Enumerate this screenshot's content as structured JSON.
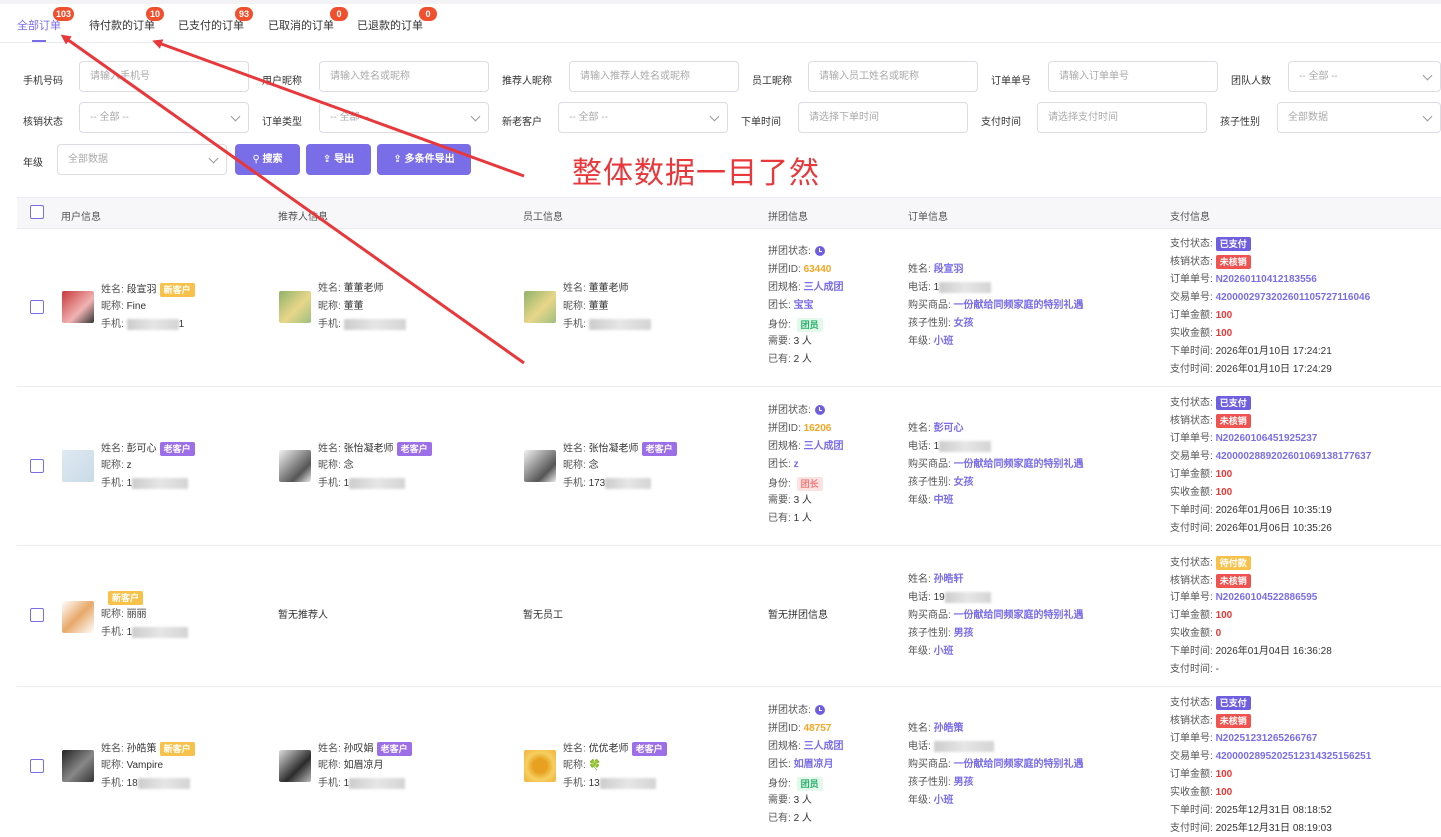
{
  "tabs": [
    {
      "label": "全部订单",
      "count": "103"
    },
    {
      "label": "待付款的订单",
      "count": "10"
    },
    {
      "label": "已支付的订单",
      "count": "93"
    },
    {
      "label": "已取消的订单",
      "count": "0"
    },
    {
      "label": "已退款的订单",
      "count": "0"
    }
  ],
  "filters": {
    "phone": {
      "label": "手机号码",
      "placeholder": "请输入手机号"
    },
    "nickname": {
      "label": "用户昵称",
      "placeholder": "请输入姓名或昵称"
    },
    "referrer": {
      "label": "推荐人昵称",
      "placeholder": "请输入推荐人姓名或昵称"
    },
    "staff": {
      "label": "员工昵称",
      "placeholder": "请输入员工姓名或昵称"
    },
    "order_no": {
      "label": "订单单号",
      "placeholder": "请输入订单单号"
    },
    "group_count": {
      "label": "团队人数",
      "value": "-- 全部 --"
    },
    "verify_status": {
      "label": "核销状态",
      "value": "-- 全部 --"
    },
    "order_type": {
      "label": "订单类型",
      "value": "-- 全部 --"
    },
    "customer_type": {
      "label": "新老客户",
      "value": "-- 全部 --"
    },
    "order_time": {
      "label": "下单时间",
      "placeholder": "请选择下单时间"
    },
    "pay_time": {
      "label": "支付时间",
      "placeholder": "请选择支付时间"
    },
    "child_gender": {
      "label": "孩子性别",
      "value": "全部数据"
    },
    "grade": {
      "label": "年级",
      "value": "全部数据"
    }
  },
  "buttons": {
    "search": "搜索",
    "export": "导出",
    "multi_export": "多条件导出"
  },
  "annotation": "整体数据一目了然",
  "columns": [
    "用户信息",
    "推荐人信息",
    "员工信息",
    "拼团信息",
    "订单信息",
    "支付信息"
  ],
  "labels": {
    "name": "姓名:",
    "nick": "昵称:",
    "phone": "手机:",
    "group_status": "拼团状态:",
    "group_id": "拼团ID:",
    "group_spec": "团规格:",
    "leader": "团长:",
    "role": "身份:",
    "need": "需要:",
    "have": "已有:",
    "order_name": "姓名:",
    "order_phone": "电话:",
    "goods": "购买商品:",
    "gender": "孩子性别:",
    "grade": "年级:",
    "pay_status": "支付状态:",
    "verify": "核销状态:",
    "order_no": "订单单号:",
    "trade_no": "交易单号:",
    "order_amount": "订单金额:",
    "paid_amount": "实收金额:",
    "order_time": "下单时间:",
    "pay_time": "支付时间:"
  },
  "rows": [
    {
      "user": {
        "name": "段宣羽",
        "tag": "新客户",
        "nick": "Fine",
        "phone": "1"
      },
      "ref": {
        "name": "董董老师",
        "nick": "董董",
        "phone": ""
      },
      "staff": {
        "name": "董董老师",
        "nick": "董董",
        "phone": ""
      },
      "group": {
        "id": "63440",
        "spec": "三人成团",
        "leader": "宝宝",
        "role": "团员",
        "need": "3 人",
        "have": "2 人"
      },
      "order": {
        "name": "段宣羽",
        "phone": "1",
        "goods": "一份献给同频家庭的特别礼遇",
        "gender": "女孩",
        "grade": "小班"
      },
      "pay": {
        "status": "已支付",
        "verify": "未核销",
        "order_no": "N20260110412183556",
        "trade_no": "4200002973202601105727116046",
        "order_amount": "100",
        "paid_amount": "100",
        "order_time": "2026年01月10日 17:24:21",
        "pay_time": "2026年01月10日 17:24:29"
      }
    },
    {
      "user": {
        "name": "彭可心",
        "tag": "老客户",
        "nick": "z",
        "phone": "1"
      },
      "ref": {
        "name": "张怡凝老师",
        "tag": "老客户",
        "nick": "念",
        "phone": "1"
      },
      "staff": {
        "name": "张怡凝老师",
        "tag": "老客户",
        "nick": "念",
        "phone": "173"
      },
      "group": {
        "id": "16206",
        "spec": "三人成团",
        "leader": "z",
        "role": "团长",
        "need": "3 人",
        "have": "1 人"
      },
      "order": {
        "name": "彭可心",
        "phone": "1",
        "goods": "一份献给同频家庭的特别礼遇",
        "gender": "女孩",
        "grade": "中班"
      },
      "pay": {
        "status": "已支付",
        "verify": "未核销",
        "order_no": "N20260106451925237",
        "trade_no": "4200002889202601069138177637",
        "order_amount": "100",
        "paid_amount": "100",
        "order_time": "2026年01月06日 10:35:19",
        "pay_time": "2026年01月06日 10:35:26"
      }
    },
    {
      "user": {
        "tag": "新客户",
        "nick": "丽丽",
        "phone": "1"
      },
      "ref_empty": "暂无推荐人",
      "staff_empty": "暂无员工",
      "group_empty": "暂无拼团信息",
      "order": {
        "name": "孙晧轩",
        "phone": "19",
        "goods": "一份献给同频家庭的特别礼遇",
        "gender": "男孩",
        "grade": "小班"
      },
      "pay": {
        "status": "待付款",
        "verify": "未核销",
        "order_no": "N20260104522886595",
        "order_amount": "100",
        "paid_amount": "0",
        "order_time": "2026年01月04日 16:36:28",
        "pay_time": "-"
      }
    },
    {
      "user": {
        "name": "孙皓策",
        "tag": "新客户",
        "nick": "Vampire",
        "phone": "18"
      },
      "ref": {
        "name": "孙叹娟",
        "tag": "老客户",
        "nick": "如眉凉月",
        "phone": "1"
      },
      "staff": {
        "name": "优优老师",
        "tag": "老客户",
        "nick": "🍀",
        "phone": "13"
      },
      "group": {
        "id": "48757",
        "spec": "三人成团",
        "leader": "如眉凉月",
        "role": "团员",
        "need": "3 人",
        "have": "2 人"
      },
      "order": {
        "name": "孙皓策",
        "phone": "",
        "goods": "一份献给同频家庭的特别礼遇",
        "gender": "男孩",
        "grade": "小班"
      },
      "pay": {
        "status": "已支付",
        "verify": "未核销",
        "order_no": "N20251231265266767",
        "trade_no": "4200002895202512314325156251",
        "order_amount": "100",
        "paid_amount": "100",
        "order_time": "2025年12月31日 08:18:52",
        "pay_time": "2025年12月31日 08:19:03"
      }
    }
  ],
  "colors": {
    "accent": "#7a6ee8",
    "badge": "#f0502d",
    "annotation": "#e8383b"
  }
}
